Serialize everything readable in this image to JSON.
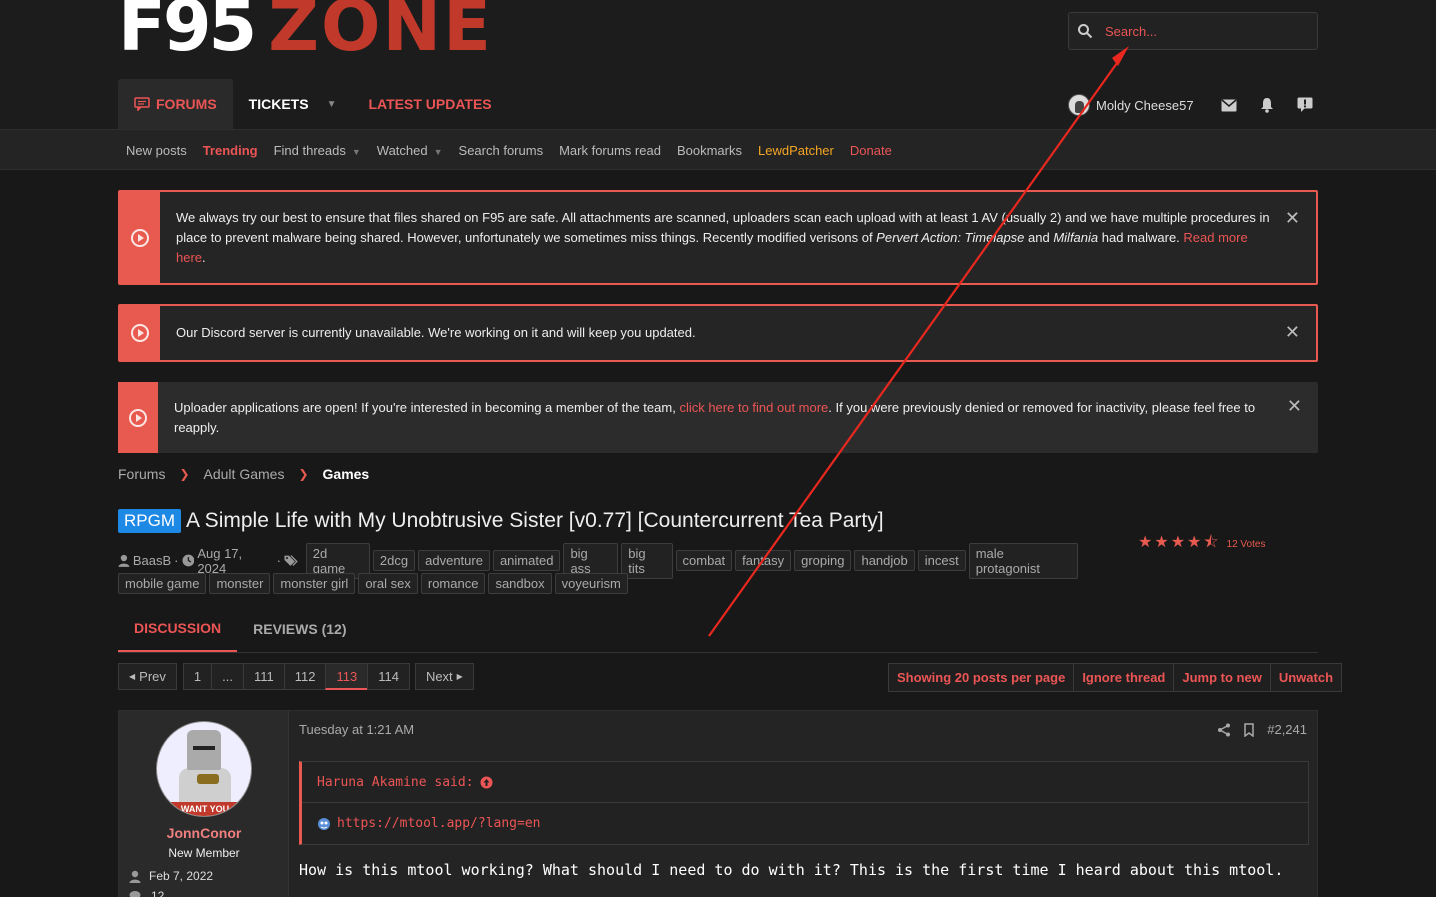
{
  "logo": {
    "part1": "F95",
    "part2": "ZONE"
  },
  "search": {
    "placeholder": "Search..."
  },
  "mainnav": {
    "forums": "FORUMS",
    "tickets": "TICKETS",
    "latest": "LATEST UPDATES"
  },
  "user": {
    "name": "Moldy Cheese57"
  },
  "subnav": {
    "new_posts": "New posts",
    "trending": "Trending",
    "find_threads": "Find threads",
    "watched": "Watched",
    "search_forums": "Search forums",
    "mark_read": "Mark forums read",
    "bookmarks": "Bookmarks",
    "lewdpatcher": "LewdPatcher",
    "donate": "Donate"
  },
  "notices": {
    "n1": {
      "text_a": "We always try our best to ensure that files shared on F95 are safe. All attachments are scanned, uploaders scan each upload with at least 1 AV (usually 2) and we have multiple procedures in place to prevent malware being shared. However, unfortunately we sometimes miss things. Recently modified verisons of ",
      "game1": "Pervert Action: Timelapse",
      "and": " and ",
      "game2": "Milfania",
      "text_b": " had malware. ",
      "link": "Read more here",
      "end": "."
    },
    "n2": {
      "text": "Our Discord server is currently unavailable. We're working on it and will keep you updated."
    },
    "n3": {
      "text_a": "Uploader applications are open! If you're interested in becoming a member of the team, ",
      "link": "click here to find out more",
      "text_b": ". If you were previously denied or removed for inactivity, please feel free to reapply."
    }
  },
  "breadcrumb": {
    "b1": "Forums",
    "b2": "Adult Games",
    "b3": "Games"
  },
  "thread": {
    "prefix": "RPGM",
    "title": "A Simple Life with My Unobtrusive Sister [v0.77] [Countercurrent Tea Party]",
    "author": "BaasB",
    "date": "Aug 17, 2024",
    "rating": 4.5,
    "votes": "12 Votes",
    "tags_row1": [
      "2d game",
      "2dcg",
      "adventure",
      "animated",
      "big ass",
      "big tits",
      "combat",
      "fantasy",
      "groping",
      "handjob",
      "incest",
      "male protagonist"
    ],
    "tags_row2": [
      "mobile game",
      "monster",
      "monster girl",
      "oral sex",
      "romance",
      "sandbox",
      "voyeurism"
    ]
  },
  "tabs": {
    "discussion": "DISCUSSION",
    "reviews": "REVIEWS (12)"
  },
  "pager": {
    "prev": "Prev",
    "p1": "1",
    "dots": "...",
    "p111": "111",
    "p112": "112",
    "p113": "113",
    "p114": "114",
    "next": "Next"
  },
  "actions": {
    "showing": "Showing 20 posts per page",
    "ignore": "Ignore thread",
    "jump": "Jump to new",
    "unwatch": "Unwatch"
  },
  "post": {
    "username": "JonnConor",
    "usertitle": "New Member",
    "joined": "Feb 7, 2022",
    "messages": "12",
    "avatar_banner": "WANT YOU",
    "date": "Tuesday at 1:21 AM",
    "number": "#2,241",
    "quote_author": "Haruna Akamine said:",
    "quote_link": "https://mtool.app/?lang=en",
    "message": "How is this mtool working? What should I need to do with it? This is the first time I heard about this mtool."
  },
  "colors": {
    "accent": "#ec5555",
    "background": "#181818",
    "prefix_blue": "#1e88e5",
    "annotation_arrow": "#e8281e"
  }
}
